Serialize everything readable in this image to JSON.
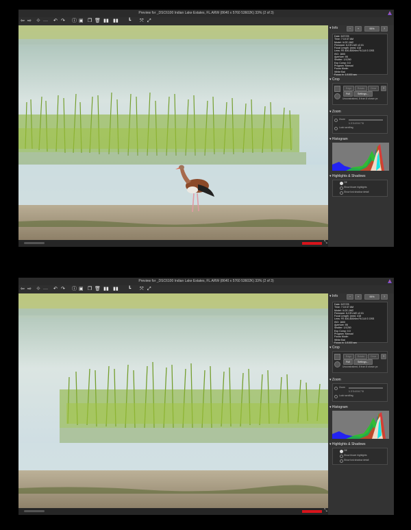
{
  "window_title": "Preview for _DSC6100 Indian Lake Estates, FL.ARW (8640 x 5760 53602K) 33% (2 of 3)",
  "toolbar": {
    "back_icon": "arrow-left-icon",
    "forward_icon": "arrow-right-icon",
    "zoom_label": "95%",
    "zoom_out_label": "−",
    "zoom_in_label": "+",
    "help_label": "?"
  },
  "panel": {
    "info": {
      "heading": "Info",
      "text": "Date: 5/27/25\nTime: 7:10:37 AM\nModel: ILCE-1M2\nFirmware: ILCE1-M2 v2.01\nFocal Length: (mm): 418\nLens: FE 400-800mm F6.3-8 G OSS\nISO: 1600\nAperture: f/8\nShutter: 1/1250\nExp Comp: 0.0\nProgram: Manual\nFocus Mode:\nWhite Bal:\nFocus in: 1/1000 sec"
    },
    "crop": {
      "heading": "Crop",
      "edge_label": "Edge",
      "rotate_label": "Rotate",
      "clear_label": "Clear",
      "full_label": "Full",
      "settings_label": "Settings...",
      "note": "Unconstrained, 8 from 8 shown px"
    },
    "zoom": {
      "heading": "Zoom",
      "zoom_label": "Zoom",
      "scale": "1 2 3 4 5 6 7 8",
      "lock_label": "Lock scrolling"
    },
    "histogram": {
      "heading": "Histogram"
    },
    "highlights": {
      "heading": "Highlights & Shadows",
      "options": [
        "Off",
        "Show blown highlights",
        "Show lost shadow detail"
      ]
    }
  },
  "colors": {
    "accent_red": "#d8141b",
    "panel_bg": "#333333",
    "titlebar_bg": "#2b2b2b"
  }
}
